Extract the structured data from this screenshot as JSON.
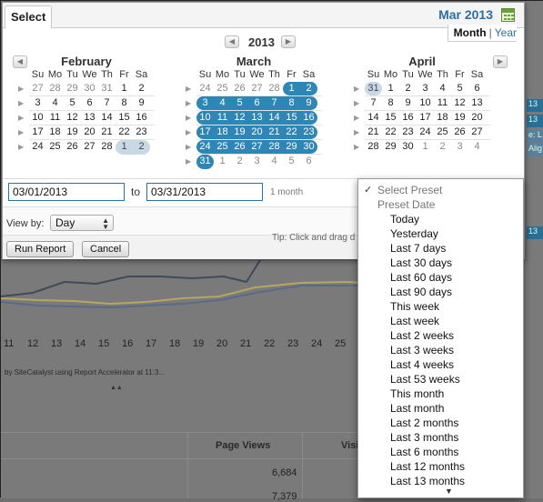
{
  "header": {
    "select_tab": "Select",
    "current_month": "Mar 2013",
    "view_month": "Month",
    "view_sep": "|",
    "view_year": "Year"
  },
  "year_nav": {
    "year": "2013"
  },
  "calendars": [
    {
      "name": "February",
      "dow": [
        "Su",
        "Mo",
        "Tu",
        "We",
        "Th",
        "Fr",
        "Sa"
      ],
      "weeks": [
        [
          {
            "d": "27",
            "o": 1
          },
          {
            "d": "28",
            "o": 1
          },
          {
            "d": "29",
            "o": 1
          },
          {
            "d": "30",
            "o": 1
          },
          {
            "d": "31",
            "o": 1
          },
          {
            "d": "1"
          },
          {
            "d": "2"
          }
        ],
        [
          {
            "d": "3"
          },
          {
            "d": "4"
          },
          {
            "d": "5"
          },
          {
            "d": "6"
          },
          {
            "d": "7"
          },
          {
            "d": "8"
          },
          {
            "d": "9"
          }
        ],
        [
          {
            "d": "10"
          },
          {
            "d": "11"
          },
          {
            "d": "12"
          },
          {
            "d": "13"
          },
          {
            "d": "14"
          },
          {
            "d": "15"
          },
          {
            "d": "16"
          }
        ],
        [
          {
            "d": "17"
          },
          {
            "d": "18"
          },
          {
            "d": "19"
          },
          {
            "d": "20"
          },
          {
            "d": "21"
          },
          {
            "d": "22"
          },
          {
            "d": "23"
          }
        ],
        [
          {
            "d": "24"
          },
          {
            "d": "25"
          },
          {
            "d": "26"
          },
          {
            "d": "27"
          },
          {
            "d": "28"
          },
          {
            "d": "1",
            "o": 1,
            "p": "s"
          },
          {
            "d": "2",
            "o": 1,
            "p": "e"
          }
        ]
      ]
    },
    {
      "name": "March",
      "dow": [
        "Su",
        "Mo",
        "Tu",
        "We",
        "Th",
        "Fr",
        "Sa"
      ],
      "weeks": [
        [
          {
            "d": "24",
            "o": 1
          },
          {
            "d": "25",
            "o": 1
          },
          {
            "d": "26",
            "o": 1
          },
          {
            "d": "27",
            "o": 1
          },
          {
            "d": "28",
            "o": 1
          },
          {
            "d": "1",
            "s": 1,
            "p": "s"
          },
          {
            "d": "2",
            "s": 1,
            "p": "e"
          }
        ],
        [
          {
            "d": "3",
            "s": 1
          },
          {
            "d": "4",
            "s": 1
          },
          {
            "d": "5",
            "s": 1
          },
          {
            "d": "6",
            "s": 1
          },
          {
            "d": "7",
            "s": 1
          },
          {
            "d": "8",
            "s": 1
          },
          {
            "d": "9",
            "s": 1
          }
        ],
        [
          {
            "d": "10",
            "s": 1
          },
          {
            "d": "11",
            "s": 1
          },
          {
            "d": "12",
            "s": 1
          },
          {
            "d": "13",
            "s": 1
          },
          {
            "d": "14",
            "s": 1
          },
          {
            "d": "15",
            "s": 1
          },
          {
            "d": "16",
            "s": 1
          }
        ],
        [
          {
            "d": "17",
            "s": 1
          },
          {
            "d": "18",
            "s": 1
          },
          {
            "d": "19",
            "s": 1
          },
          {
            "d": "20",
            "s": 1
          },
          {
            "d": "21",
            "s": 1
          },
          {
            "d": "22",
            "s": 1
          },
          {
            "d": "23",
            "s": 1
          }
        ],
        [
          {
            "d": "24",
            "s": 1
          },
          {
            "d": "25",
            "s": 1
          },
          {
            "d": "26",
            "s": 1
          },
          {
            "d": "27",
            "s": 1
          },
          {
            "d": "28",
            "s": 1
          },
          {
            "d": "29",
            "s": 1
          },
          {
            "d": "30",
            "s": 1
          }
        ],
        [
          {
            "d": "31",
            "s": 1,
            "p": "one"
          },
          {
            "d": "1",
            "o": 1
          },
          {
            "d": "2",
            "o": 1
          },
          {
            "d": "3",
            "o": 1
          },
          {
            "d": "4",
            "o": 1
          },
          {
            "d": "5",
            "o": 1
          },
          {
            "d": "6",
            "o": 1
          }
        ]
      ]
    },
    {
      "name": "April",
      "dow": [
        "Su",
        "Mo",
        "Tu",
        "We",
        "Th",
        "Fr",
        "Sa"
      ],
      "weeks": [
        [
          {
            "d": "31",
            "o": 1,
            "p": "one"
          },
          {
            "d": "1"
          },
          {
            "d": "2"
          },
          {
            "d": "3"
          },
          {
            "d": "4"
          },
          {
            "d": "5"
          },
          {
            "d": "6"
          }
        ],
        [
          {
            "d": "7"
          },
          {
            "d": "8"
          },
          {
            "d": "9"
          },
          {
            "d": "10"
          },
          {
            "d": "11"
          },
          {
            "d": "12"
          },
          {
            "d": "13"
          }
        ],
        [
          {
            "d": "14"
          },
          {
            "d": "15"
          },
          {
            "d": "16"
          },
          {
            "d": "17"
          },
          {
            "d": "18"
          },
          {
            "d": "19"
          },
          {
            "d": "20"
          }
        ],
        [
          {
            "d": "21"
          },
          {
            "d": "22"
          },
          {
            "d": "23"
          },
          {
            "d": "24"
          },
          {
            "d": "25"
          },
          {
            "d": "26"
          },
          {
            "d": "27"
          }
        ],
        [
          {
            "d": "28"
          },
          {
            "d": "29"
          },
          {
            "d": "30"
          },
          {
            "d": "1",
            "o": 1
          },
          {
            "d": "2",
            "o": 1
          },
          {
            "d": "3",
            "o": 1
          },
          {
            "d": "4",
            "o": 1
          }
        ]
      ]
    }
  ],
  "range": {
    "start": "03/01/2013",
    "to_label": "to",
    "end": "03/31/2013",
    "duration": "1 month"
  },
  "view_by": {
    "label": "View by:",
    "value": "Day"
  },
  "actions": {
    "run_report": "Run Report",
    "cancel": "Cancel",
    "tip": "Tip: Click and drag d"
  },
  "preset_dropdown": {
    "selected": "Select Preset",
    "group": "Preset Date",
    "options": [
      "Today",
      "Yesterday",
      "Last 7 days",
      "Last 30 days",
      "Last 60 days",
      "Last 90 days",
      "This week",
      "Last week",
      "Last 2 weeks",
      "Last 3 weeks",
      "Last 4 weeks",
      "Last 53 weeks",
      "This month",
      "Last month",
      "Last 2 months",
      "Last 3 months",
      "Last 6 months",
      "Last 12 months",
      "Last 13 months"
    ]
  },
  "background": {
    "axis_ticks": [
      "11",
      "12",
      "13",
      "14",
      "15",
      "16",
      "17",
      "18",
      "19",
      "20",
      "21",
      "22",
      "23",
      "24",
      "25"
    ],
    "note": "by SiteCatalyst using Report Accelerator at 11:3...",
    "table_header": "Page Views",
    "table_header_2": "Visi",
    "table_values": [
      "6,684",
      "7,379"
    ],
    "right_strip": [
      "13",
      "13",
      "e: L",
      "Alig",
      "13"
    ]
  }
}
